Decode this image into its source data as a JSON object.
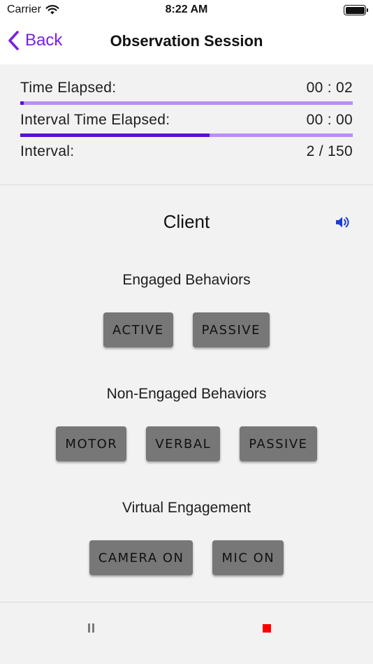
{
  "status_bar": {
    "carrier": "Carrier",
    "time": "8:22 AM"
  },
  "nav": {
    "back_label": "Back",
    "title": "Observation Session"
  },
  "timers": {
    "time_elapsed_label": "Time Elapsed:",
    "time_elapsed_value": "00 : 02",
    "time_elapsed_progress": 0.01,
    "interval_time_label": "Interval Time Elapsed:",
    "interval_time_value": "00 : 00",
    "interval_time_progress": 0.57,
    "interval_label": "Interval:",
    "interval_value": "2 / 150"
  },
  "client": {
    "title": "Client",
    "speaker_icon": "speaker-icon"
  },
  "sections": {
    "engaged": {
      "label": "Engaged Behaviors",
      "buttons": [
        "ACTIVE",
        "PASSIVE"
      ]
    },
    "non_engaged": {
      "label": "Non-Engaged Behaviors",
      "buttons": [
        "MOTOR",
        "VERBAL",
        "PASSIVE"
      ]
    },
    "virtual": {
      "label": "Virtual Engagement",
      "buttons": [
        "CAMERA ON",
        "MIC ON"
      ]
    }
  },
  "controls": {
    "pause_icon": "pause-icon",
    "stop_icon": "stop-icon"
  },
  "colors": {
    "accent": "#7b1fe3",
    "bar_fill": "#5b0fd6",
    "bar_track": "#b98ef0",
    "button": "#777777",
    "stop": "#ff0000"
  }
}
